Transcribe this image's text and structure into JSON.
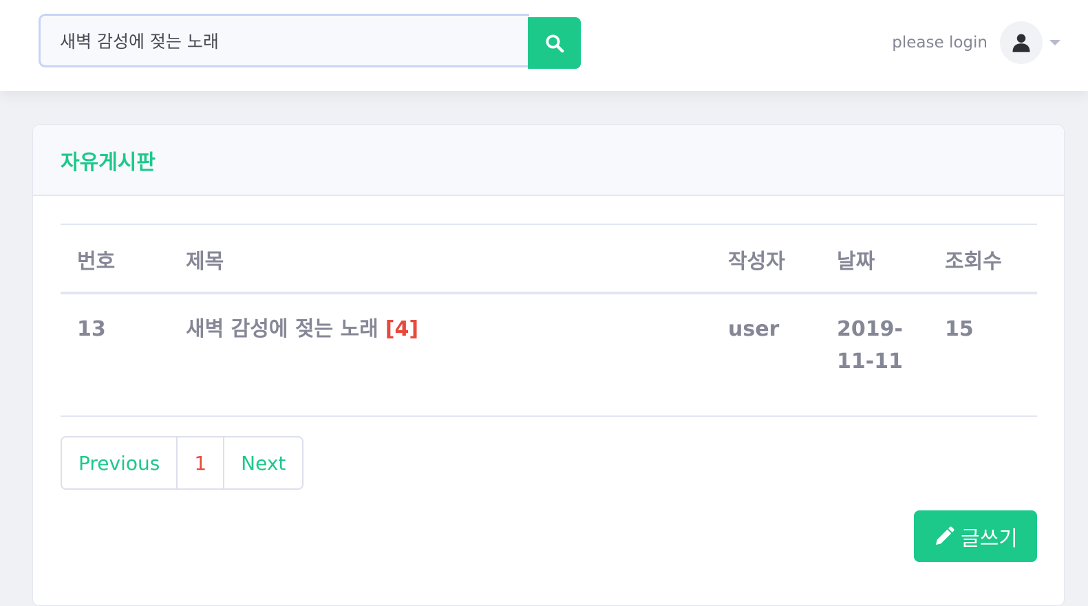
{
  "search": {
    "value": "새벽 감성에 젖는 노래",
    "button_icon": "search-icon"
  },
  "user": {
    "login_text": "please login",
    "avatar_icon": "user-icon",
    "dropdown_icon": "caret-down-icon"
  },
  "board": {
    "title": "자유게시판",
    "columns": [
      "번호",
      "제목",
      "작성자",
      "날짜",
      "조회수"
    ],
    "rows": [
      {
        "number": "13",
        "title": "새벽 감성에 젖는 노래",
        "comment_count": "[4]",
        "author": "user",
        "date_line1": "2019-",
        "date_line2": "11-11",
        "views": "15"
      }
    ]
  },
  "pagination": {
    "previous": "Previous",
    "current": "1",
    "next": "Next"
  },
  "write_button": {
    "label": "글쓰기",
    "icon": "pencil-icon"
  },
  "colors": {
    "accent": "#1cc88a",
    "danger": "#e74a3b",
    "text_muted": "#858796"
  }
}
